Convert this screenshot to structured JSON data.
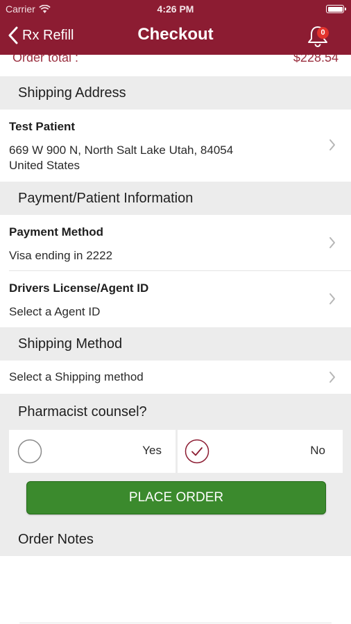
{
  "status_bar": {
    "carrier": "Carrier",
    "time": "4:26 PM"
  },
  "nav": {
    "back_label": "Rx Refill",
    "title": "Checkout",
    "notification_count": "0"
  },
  "order_total": {
    "label": "Order total :",
    "value": "$228.54"
  },
  "shipping_address": {
    "header": "Shipping Address",
    "name": "Test Patient",
    "address_line1": "669 W 900 N, North Salt Lake Utah, 84054",
    "address_line2": "United States"
  },
  "payment": {
    "header": "Payment/Patient Information",
    "method_label": "Payment Method",
    "method_value": "Visa ending in 2222",
    "license_label": "Drivers License/Agent ID",
    "license_value": "Select a Agent ID"
  },
  "shipping_method": {
    "header": "Shipping Method",
    "value": "Select a Shipping method"
  },
  "pharmacist_counsel": {
    "header": "Pharmacist counsel?",
    "yes_label": "Yes",
    "no_label": "No",
    "selected": "No"
  },
  "place_order_label": "PLACE ORDER",
  "order_notes": {
    "header": "Order Notes"
  },
  "colors": {
    "brand": "#8c1c32",
    "button_green": "#3b8a2d",
    "badge_red": "#e2332d",
    "section_bg": "#ececec"
  }
}
